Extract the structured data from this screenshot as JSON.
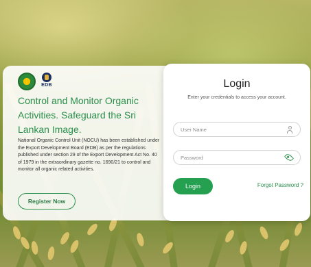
{
  "brand": {
    "logo_primary": "organic-control-unit-logo",
    "logo_secondary_text": "EDB"
  },
  "hero": {
    "headline": "Control and Monitor Organic Activities. Safeguard the Sri Lankan Image.",
    "description": "National Organic Control Unit (NOCU) has been established under the Export Development Board (EDB) as per the regulations published under section 29 of the Export Development Act No. 40 of 1979 in the extraordinary gazette no. 1690/21 to control and monitor all organic related activities.",
    "register_label": "Register Now"
  },
  "login": {
    "title": "Login",
    "subtitle": "Enter your credentials to access your account.",
    "username_placeholder": "User Name",
    "password_placeholder": "Password",
    "login_label": "Login",
    "forgot_label": "Forgot Password ?"
  },
  "colors": {
    "accent": "#24a050",
    "headline": "#2a8f4b"
  }
}
